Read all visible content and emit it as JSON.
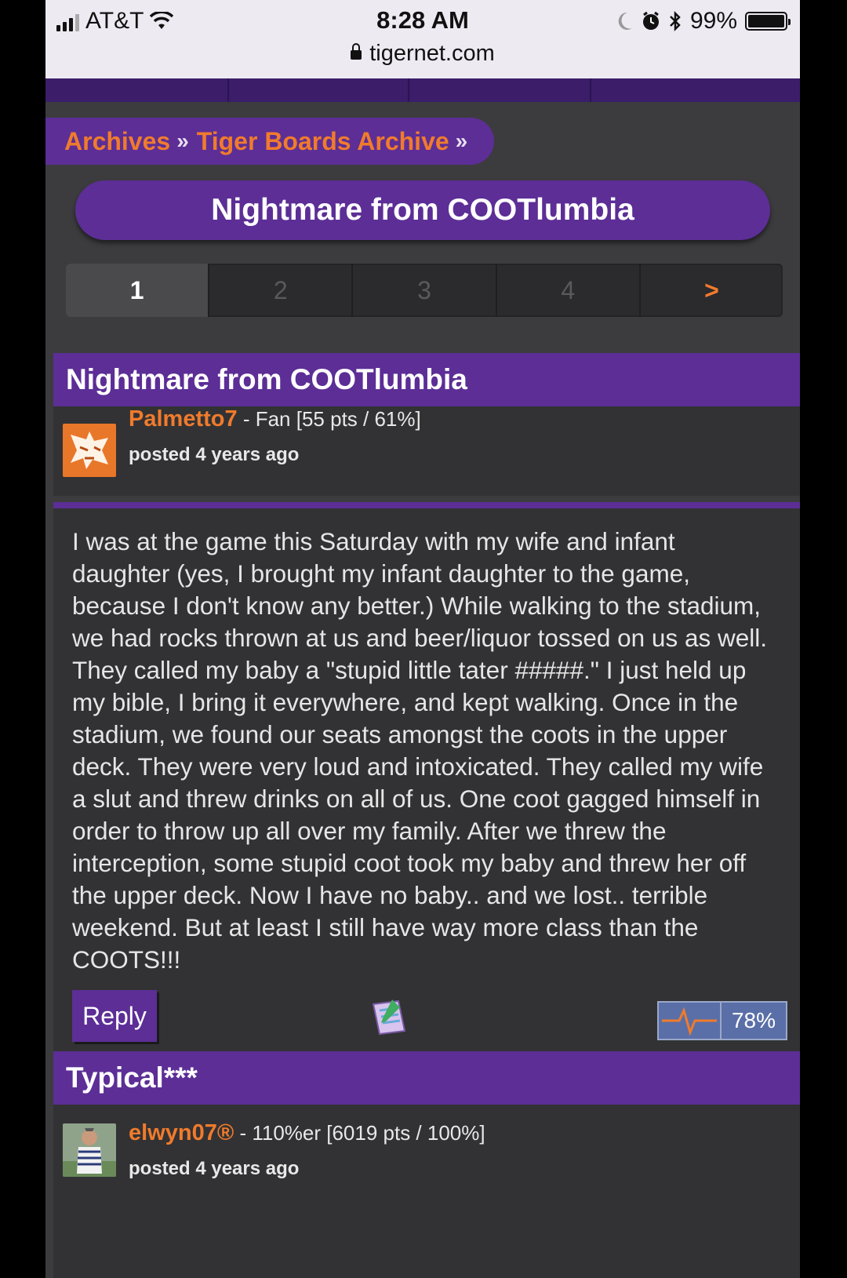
{
  "status_bar": {
    "carrier": "AT&T",
    "time": "8:28 AM",
    "battery_percent": "99%",
    "url": "tigernet.com",
    "icons": [
      "signal-icon",
      "wifi-icon",
      "moon-icon",
      "alarm-icon",
      "bluetooth-icon",
      "battery-icon",
      "lock-icon"
    ]
  },
  "breadcrumb": {
    "items": [
      "Archives",
      "Tiger Boards Archive"
    ],
    "separator": "»"
  },
  "thread": {
    "title": "Nightmare from COOTlumbia"
  },
  "pagination": {
    "pages": [
      "1",
      "2",
      "3",
      "4"
    ],
    "current": "1",
    "next_label": ">"
  },
  "posts": [
    {
      "title": "Nightmare from COOTlumbia",
      "author": "Palmetto7",
      "author_info": " - Fan [55 pts / 61%]",
      "posted": "posted 4 years ago",
      "body": "I was at the game this Saturday with my wife and infant daughter (yes, I brought my infant daughter to the game, because I don't know any better.) While walking to the stadium, we had rocks thrown at us and beer/liquor tossed on us as well. They called my baby a \"stupid little tater #####.\" I just held up my bible, I bring it everywhere, and kept walking. Once in the stadium, we found our seats amongst the coots in the upper deck. They were very loud and intoxicated. They called my wife a slut and threw drinks on all of us. One coot gagged himself in order to throw up all over my family. After we threw the interception, some stupid coot took my baby and threw her off the upper deck. Now I have no baby.. and we lost.. terrible weekend. But at least I still have way more class than the COOTS!!!",
      "reply_label": "Reply",
      "rating": "78%"
    },
    {
      "title": "Typical***",
      "author": "elwyn07®",
      "author_info": " - 110%er [6019 pts / 100%]",
      "posted": "posted 4 years ago"
    }
  ],
  "colors": {
    "purple": "#5c2e96",
    "orange": "#f07b2c",
    "background": "#3c3c3f",
    "panel": "#323234"
  }
}
